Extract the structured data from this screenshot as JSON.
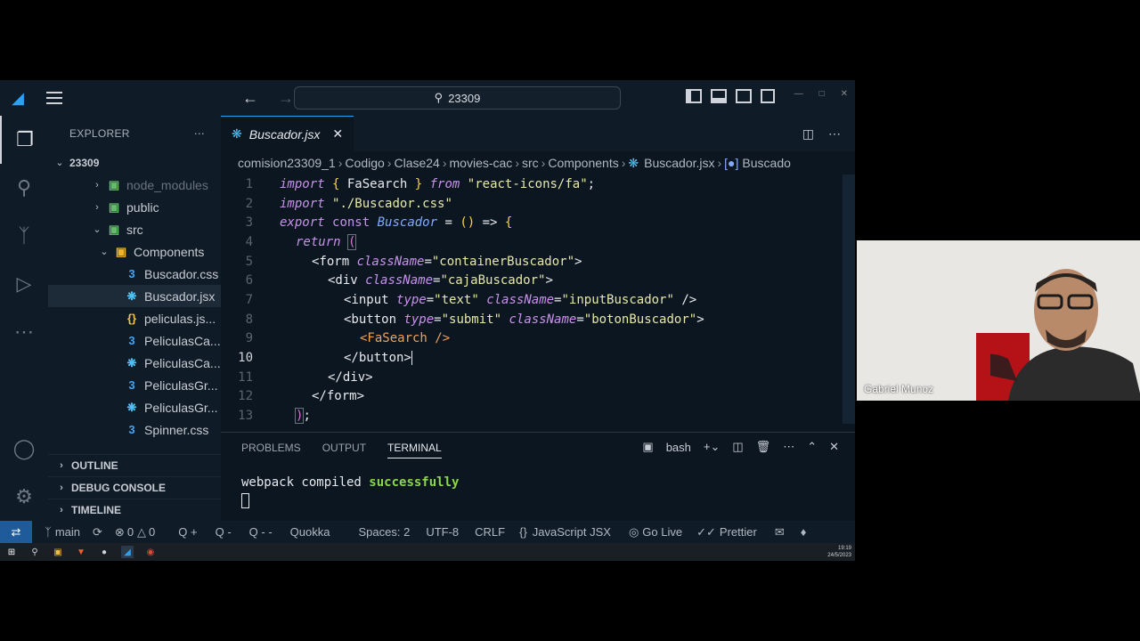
{
  "titlebar": {
    "search_text": "23309"
  },
  "sidebar": {
    "header": "EXPLORER",
    "root_folder": "23309",
    "items": [
      {
        "label": "node_modules",
        "kind": "folder"
      },
      {
        "label": "public",
        "kind": "folder"
      },
      {
        "label": "src",
        "kind": "folder"
      },
      {
        "label": "Components",
        "kind": "folder"
      },
      {
        "label": "Buscador.css",
        "kind": "css"
      },
      {
        "label": "Buscador.jsx",
        "kind": "react"
      },
      {
        "label": "peliculas.js...",
        "kind": "json"
      },
      {
        "label": "PeliculasCa...",
        "kind": "css"
      },
      {
        "label": "PeliculasCa...",
        "kind": "react"
      },
      {
        "label": "PeliculasGr...",
        "kind": "css"
      },
      {
        "label": "PeliculasGr...",
        "kind": "react"
      },
      {
        "label": "Spinner.css",
        "kind": "css"
      }
    ],
    "sections": [
      "OUTLINE",
      "DEBUG CONSOLE",
      "TIMELINE"
    ]
  },
  "editor": {
    "tab_label": "Buscador.jsx",
    "breadcrumb": [
      "comision23309_1",
      "Codigo",
      "Clase24",
      "movies-cac",
      "src",
      "Components",
      "Buscador.jsx",
      "Buscado"
    ],
    "current_line": "10",
    "line_numbers": [
      "1",
      "2",
      "3",
      "4",
      "5",
      "6",
      "7",
      "8",
      "9",
      "10",
      "11",
      "12",
      "13"
    ]
  },
  "panel": {
    "tabs": [
      "PROBLEMS",
      "OUTPUT",
      "TERMINAL"
    ],
    "active_tab": "TERMINAL",
    "shell": "bash",
    "terminal_text": "webpack compiled",
    "terminal_status": "successfully"
  },
  "statusbar": {
    "branch": "main",
    "errors": "0",
    "warnings": "0",
    "q1": "Q +",
    "q2": "Q -",
    "q3": "Q - -",
    "quokka": "Quokka",
    "spaces": "Spaces: 2",
    "encoding": "UTF-8",
    "eol": "CRLF",
    "language": "JavaScript JSX",
    "golive": "Go Live",
    "prettier": "Prettier"
  },
  "taskbar": {
    "time": "19:19",
    "date": "24/5/2023"
  },
  "webcam": {
    "name": "Gabriel Munoz"
  },
  "colors": {
    "accent": "#2f9ff0",
    "bg": "#0c1620",
    "success": "#8bd649"
  }
}
